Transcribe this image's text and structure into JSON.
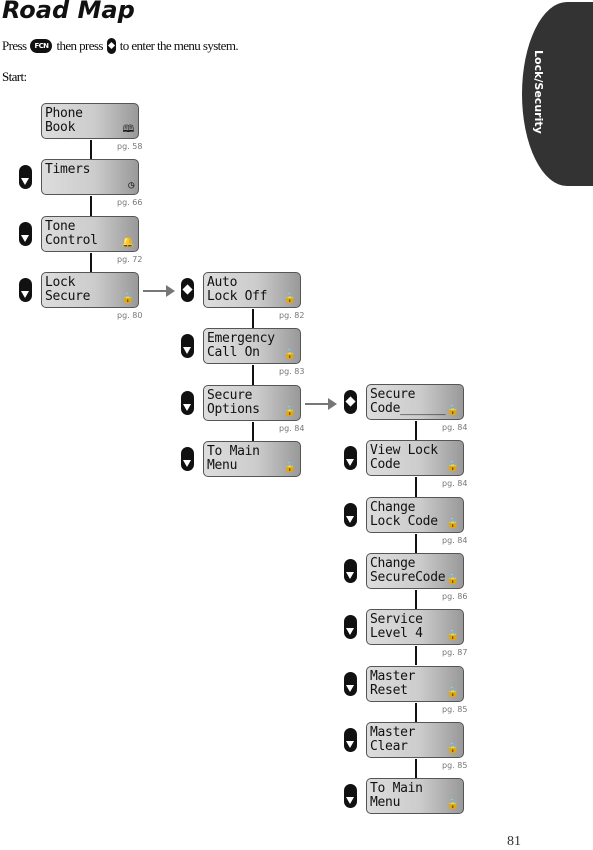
{
  "title": "Road Map",
  "intro": {
    "press": "Press",
    "fcn_key": "FCN",
    "then_press": "then press",
    "rest": "to enter the menu system."
  },
  "start": "Start:",
  "side_tab": "Lock/Security",
  "page_number": "81",
  "columns": [
    {
      "items": [
        {
          "line1": "Phone",
          "line2": "Book",
          "icon": "book-icon",
          "glyph": "🕮",
          "page": "pg. 58",
          "nav": "none"
        },
        {
          "line1": "Timers",
          "line2": "",
          "icon": "clock-icon",
          "glyph": "◷",
          "page": "pg. 66",
          "nav": "down"
        },
        {
          "line1": "Tone",
          "line2": "Control",
          "icon": "bell-icon",
          "glyph": "🔔",
          "page": "pg. 72",
          "nav": "down"
        },
        {
          "line1": "Lock",
          "line2": "Secure",
          "icon": "lock-icon",
          "glyph": "🔒",
          "page": "pg. 80",
          "nav": "down"
        }
      ]
    },
    {
      "items": [
        {
          "line1": "Auto",
          "line2": "Lock Off",
          "icon": "lock-icon",
          "glyph": "🔒",
          "page": "pg. 82",
          "nav": "select"
        },
        {
          "line1": "Emergency",
          "line2": "Call On",
          "icon": "lock-icon",
          "glyph": "🔒",
          "page": "pg. 83",
          "nav": "down"
        },
        {
          "line1": "Secure",
          "line2": "Options",
          "icon": "lock-icon",
          "glyph": "🔒",
          "page": "pg. 84",
          "nav": "down"
        },
        {
          "line1": "To Main",
          "line2": "Menu",
          "icon": "lock-icon",
          "glyph": "🔒",
          "page": "",
          "nav": "down"
        }
      ]
    },
    {
      "items": [
        {
          "line1": "Secure",
          "line2": "Code______",
          "icon": "lock-icon",
          "glyph": "🔒",
          "page": "pg. 84",
          "nav": "select"
        },
        {
          "line1": "View Lock",
          "line2": "Code",
          "icon": "lock-icon",
          "glyph": "🔒",
          "page": "pg. 84",
          "nav": "down"
        },
        {
          "line1": "Change",
          "line2": "Lock Code",
          "icon": "lock-icon",
          "glyph": "🔒",
          "page": "pg. 84",
          "nav": "down"
        },
        {
          "line1": "Change",
          "line2": "SecureCode",
          "icon": "lock-icon",
          "glyph": "🔒",
          "page": "pg. 86",
          "nav": "down"
        },
        {
          "line1": "Service",
          "line2": "Level 4",
          "icon": "lock-icon",
          "glyph": "🔒",
          "page": "pg. 87",
          "nav": "down"
        },
        {
          "line1": "Master",
          "line2": "Reset",
          "icon": "lock-icon",
          "glyph": "🔒",
          "page": "pg. 85",
          "nav": "down"
        },
        {
          "line1": "Master",
          "line2": "Clear",
          "icon": "lock-icon",
          "glyph": "🔒",
          "page": "pg. 85",
          "nav": "down"
        },
        {
          "line1": "To Main",
          "line2": "Menu",
          "icon": "lock-icon",
          "glyph": "🔒",
          "page": "",
          "nav": "down"
        }
      ]
    }
  ]
}
